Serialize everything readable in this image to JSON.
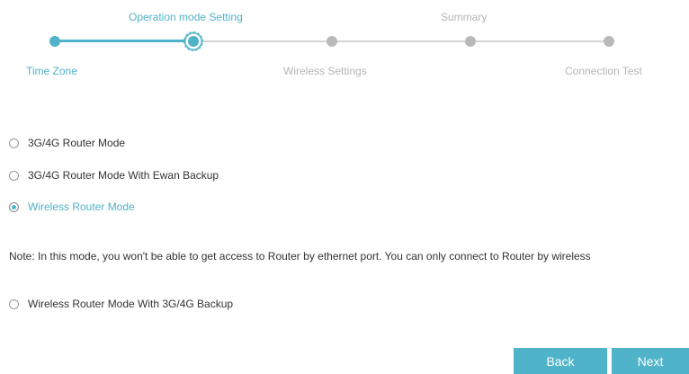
{
  "wizard": {
    "steps_top": [
      {
        "label": "Operation mode Setting",
        "state": "current"
      },
      {
        "label": "Summary",
        "state": "pending"
      }
    ],
    "steps_bottom": [
      {
        "label": "Time Zone",
        "state": "done"
      },
      {
        "label": "Wireless Settings",
        "state": "pending"
      },
      {
        "label": "Connection Test",
        "state": "pending"
      }
    ],
    "current_step_index": 1,
    "total_steps": 5
  },
  "options": [
    {
      "label": "3G/4G Router Mode",
      "checked": false
    },
    {
      "label": "3G/4G Router Mode With Ewan Backup",
      "checked": false
    },
    {
      "label": "Wireless Router Mode",
      "checked": true
    },
    {
      "label": "Wireless Router Mode With 3G/4G Backup",
      "checked": false
    }
  ],
  "note": "Note: In this mode, you won't be able to get access to Router by ethernet port. You can only connect to Router by wireless",
  "buttons": {
    "back": "Back",
    "next": "Next"
  },
  "colors": {
    "accent": "#4fb3c9",
    "inactive": "#b9b9b9",
    "text": "#333333"
  }
}
